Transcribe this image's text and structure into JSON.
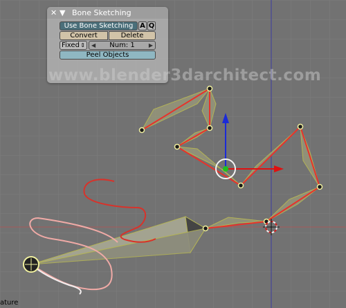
{
  "panel": {
    "title": "Bone Sketching",
    "close_icon": "close-icon",
    "collapse_icon": "collapse-triangle-icon",
    "use_bone_sketching": "Use Bone Sketching",
    "btn_a": "A",
    "btn_q": "Q",
    "convert": "Convert",
    "delete": "Delete",
    "mode_value": "Fixed",
    "num_field": "Num: 1",
    "peel_objects": "Peel Objects"
  },
  "watermark": "www.blender3darchitect.com",
  "status_text": "ature",
  "colors": {
    "viewport_bg": "#727272",
    "grid": "#7c7c7c",
    "bone_fill": "#9b9b7b",
    "sketch_red": "#e8322a",
    "stroke_pale": "#f0aaa6",
    "axis_x": "#e01010",
    "axis_y": "#2222cc",
    "accent_toggle": "#4a6f7a"
  }
}
